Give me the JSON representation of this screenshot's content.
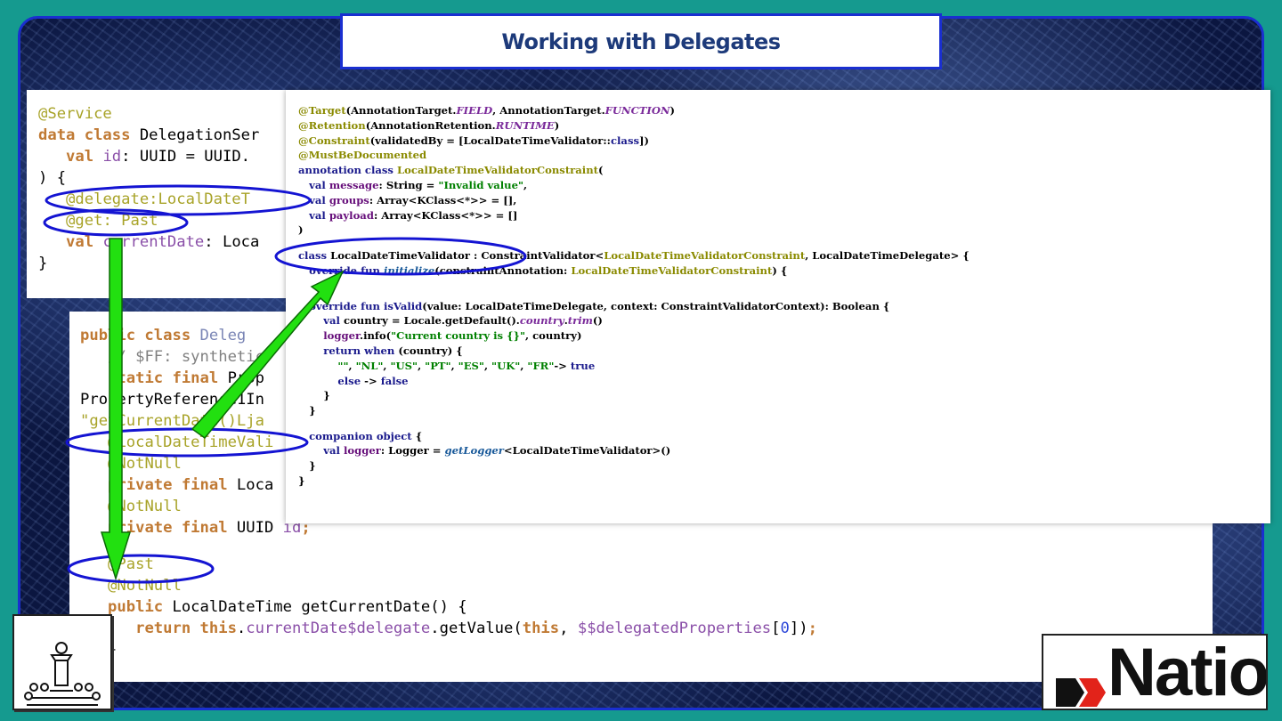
{
  "slide": {
    "title": "Working with Delegates"
  },
  "kotlin_panel": {
    "lines": [
      [
        {
          "t": "@Service",
          "c": "ann"
        }
      ],
      [
        {
          "t": "data class ",
          "c": "kw"
        },
        {
          "t": "DelegationSer",
          "c": ""
        }
      ],
      [
        {
          "t": "   ",
          "c": ""
        },
        {
          "t": "val ",
          "c": "kw"
        },
        {
          "t": "id",
          "c": "prop"
        },
        {
          "t": ": UUID = UUID.",
          "c": ""
        }
      ],
      [
        {
          "t": ") {",
          "c": ""
        }
      ],
      [
        {
          "t": "   ",
          "c": ""
        },
        {
          "t": "@delegate:LocalDateT",
          "c": "ann"
        }
      ],
      [
        {
          "t": "   ",
          "c": ""
        },
        {
          "t": "@get: Past",
          "c": "ann"
        }
      ],
      [
        {
          "t": "   ",
          "c": ""
        },
        {
          "t": "val ",
          "c": "kw"
        },
        {
          "t": "currentDate",
          "c": "prop"
        },
        {
          "t": ": Loca",
          "c": ""
        }
      ],
      [
        {
          "t": "}",
          "c": ""
        }
      ]
    ]
  },
  "java_panel": {
    "lines": [
      [
        {
          "t": "public class ",
          "c": "kw"
        },
        {
          "t": "Deleg",
          "c": "dim"
        }
      ],
      [
        {
          "t": "   ",
          "c": ""
        },
        {
          "t": "// $FF: synthetic",
          "c": "cmt"
        }
      ],
      [
        {
          "t": "   ",
          "c": ""
        },
        {
          "t": "static final ",
          "c": "kw"
        },
        {
          "t": "Prop",
          "c": ""
        }
      ],
      [
        {
          "t": "PropertyReference1In",
          "c": ""
        }
      ],
      [
        {
          "t": "\"getCurrentDate()Lja",
          "c": "ann"
        }
      ],
      [
        {
          "t": "   ",
          "c": ""
        },
        {
          "t": "@LocalDateTimeVali",
          "c": "ann"
        }
      ],
      [
        {
          "t": "   ",
          "c": ""
        },
        {
          "t": "@NotNull",
          "c": "ann"
        }
      ],
      [
        {
          "t": "   ",
          "c": ""
        },
        {
          "t": "private final ",
          "c": "kw"
        },
        {
          "t": "Loca",
          "c": ""
        }
      ],
      [
        {
          "t": "   ",
          "c": ""
        },
        {
          "t": "@NotNull",
          "c": "ann"
        }
      ],
      [
        {
          "t": "   ",
          "c": ""
        },
        {
          "t": "private final ",
          "c": "kw"
        },
        {
          "t": "UUID ",
          "c": ""
        },
        {
          "t": "id",
          "c": "prop"
        },
        {
          "t": ";",
          "c": "kw"
        }
      ],
      [
        {
          "t": "",
          "c": ""
        }
      ],
      [
        {
          "t": "   ",
          "c": ""
        },
        {
          "t": "@Past",
          "c": "ann"
        }
      ],
      [
        {
          "t": "   ",
          "c": ""
        },
        {
          "t": "@NotNull",
          "c": "ann"
        }
      ],
      [
        {
          "t": "   ",
          "c": ""
        },
        {
          "t": "public ",
          "c": "kw"
        },
        {
          "t": "LocalDateTime getCurrentDate() {",
          "c": ""
        }
      ],
      [
        {
          "t": "      ",
          "c": ""
        },
        {
          "t": "return this",
          "c": "kw"
        },
        {
          "t": ".",
          "c": ""
        },
        {
          "t": "currentDate$delegate",
          "c": "prop"
        },
        {
          "t": ".getValue(",
          "c": ""
        },
        {
          "t": "this",
          "c": "kw"
        },
        {
          "t": ", ",
          "c": ""
        },
        {
          "t": "$$delegatedProperties",
          "c": "prop"
        },
        {
          "t": "[",
          "c": ""
        },
        {
          "t": "0",
          "c": "num"
        },
        {
          "t": "])",
          "c": ""
        },
        {
          "t": ";",
          "c": "kw"
        }
      ],
      [
        {
          "t": "   }",
          "c": ""
        }
      ]
    ]
  },
  "validator_panel": {
    "lines": [
      [
        {
          "t": "@Target",
          "c": "ca"
        },
        {
          "t": "(AnnotationTarget.",
          "c": ""
        },
        {
          "t": "FIELD",
          "c": "cp"
        },
        {
          "t": ", AnnotationTarget.",
          "c": ""
        },
        {
          "t": "FUNCTION",
          "c": "cp"
        },
        {
          "t": ")",
          "c": ""
        }
      ],
      [
        {
          "t": "@Retention",
          "c": "ca"
        },
        {
          "t": "(AnnotationRetention.",
          "c": ""
        },
        {
          "t": "RUNTIME",
          "c": "cp"
        },
        {
          "t": ")",
          "c": ""
        }
      ],
      [
        {
          "t": "@Constraint",
          "c": "ca"
        },
        {
          "t": "(validatedBy = [LocalDateTimeValidator::",
          "c": ""
        },
        {
          "t": "class",
          "c": "ck"
        },
        {
          "t": "])",
          "c": ""
        }
      ],
      [
        {
          "t": "@MustBeDocumented",
          "c": "ca"
        }
      ],
      [
        {
          "t": "annotation class ",
          "c": "ck"
        },
        {
          "t": "LocalDateTimeValidatorConstraint",
          "c": "ct"
        },
        {
          "t": "(",
          "c": ""
        }
      ],
      [
        {
          "t": "   ",
          "c": ""
        },
        {
          "t": "val ",
          "c": "ck"
        },
        {
          "t": "message",
          "c": "cv"
        },
        {
          "t": ": String = ",
          "c": ""
        },
        {
          "t": "\"Invalid value\"",
          "c": "cs"
        },
        {
          "t": ",",
          "c": ""
        }
      ],
      [
        {
          "t": "   ",
          "c": ""
        },
        {
          "t": "val ",
          "c": "ck"
        },
        {
          "t": "groups",
          "c": "cv"
        },
        {
          "t": ": Array<KClass<*>> = [],",
          "c": ""
        }
      ],
      [
        {
          "t": "   ",
          "c": ""
        },
        {
          "t": "val ",
          "c": "ck"
        },
        {
          "t": "payload",
          "c": "cv"
        },
        {
          "t": ": Array<KClass<*>> = []",
          "c": ""
        }
      ],
      [
        {
          "t": ")",
          "c": ""
        }
      ],
      [
        {
          "t": "",
          "c": ""
        }
      ],
      [
        {
          "t": "class ",
          "c": "ck"
        },
        {
          "t": "LocalDateTimeValidator : ConstraintValidator<",
          "c": ""
        },
        {
          "t": "LocalDateTimeValidatorConstraint",
          "c": "ct"
        },
        {
          "t": ", LocalDateTimeDelegate> {",
          "c": ""
        }
      ],
      [
        {
          "t": "   ",
          "c": ""
        },
        {
          "t": "override fun ",
          "c": "ck"
        },
        {
          "t": "initialize",
          "c": "cf"
        },
        {
          "t": "(constraintAnnotation: ",
          "c": ""
        },
        {
          "t": "LocalDateTimeValidatorConstraint",
          "c": "ct"
        },
        {
          "t": ") {",
          "c": ""
        }
      ],
      [
        {
          "t": "",
          "c": ""
        }
      ],
      [
        {
          "t": "",
          "c": ""
        }
      ],
      [
        {
          "t": "   ",
          "c": ""
        },
        {
          "t": "override fun ",
          "c": "ck"
        },
        {
          "t": "isValid",
          "c": "ck"
        },
        {
          "t": "(value: LocalDateTimeDelegate, context: ConstraintValidatorContext): Boolean {",
          "c": ""
        }
      ],
      [
        {
          "t": "       ",
          "c": ""
        },
        {
          "t": "val ",
          "c": "ck"
        },
        {
          "t": "country = Locale.getDefault().",
          "c": ""
        },
        {
          "t": "country",
          "c": "cp"
        },
        {
          "t": ".",
          "c": ""
        },
        {
          "t": "trim",
          "c": "cp"
        },
        {
          "t": "()",
          "c": ""
        }
      ],
      [
        {
          "t": "       ",
          "c": ""
        },
        {
          "t": "logger",
          "c": "cv"
        },
        {
          "t": ".info(",
          "c": ""
        },
        {
          "t": "\"Current country is {}\"",
          "c": "cs"
        },
        {
          "t": ", country)",
          "c": ""
        }
      ],
      [
        {
          "t": "       ",
          "c": ""
        },
        {
          "t": "return when ",
          "c": "ck"
        },
        {
          "t": "(country) {",
          "c": ""
        }
      ],
      [
        {
          "t": "           ",
          "c": ""
        },
        {
          "t": "\"\"",
          "c": "cs"
        },
        {
          "t": ", ",
          "c": ""
        },
        {
          "t": "\"NL\"",
          "c": "cs"
        },
        {
          "t": ", ",
          "c": ""
        },
        {
          "t": "\"US\"",
          "c": "cs"
        },
        {
          "t": ", ",
          "c": ""
        },
        {
          "t": "\"PT\"",
          "c": "cs"
        },
        {
          "t": ", ",
          "c": ""
        },
        {
          "t": "\"ES\"",
          "c": "cs"
        },
        {
          "t": ", ",
          "c": ""
        },
        {
          "t": "\"UK\"",
          "c": "cs"
        },
        {
          "t": ", ",
          "c": ""
        },
        {
          "t": "\"FR\"",
          "c": "cs"
        },
        {
          "t": "-> ",
          "c": ""
        },
        {
          "t": "true",
          "c": "ck"
        }
      ],
      [
        {
          "t": "           ",
          "c": ""
        },
        {
          "t": "else ",
          "c": "ck"
        },
        {
          "t": "-> ",
          "c": ""
        },
        {
          "t": "false",
          "c": "ck"
        }
      ],
      [
        {
          "t": "       }",
          "c": ""
        }
      ],
      [
        {
          "t": "   }",
          "c": ""
        }
      ],
      [
        {
          "t": "",
          "c": ""
        }
      ],
      [
        {
          "t": "   ",
          "c": ""
        },
        {
          "t": "companion object ",
          "c": "ck"
        },
        {
          "t": "{",
          "c": ""
        }
      ],
      [
        {
          "t": "       ",
          "c": ""
        },
        {
          "t": "val ",
          "c": "ck"
        },
        {
          "t": "logger",
          "c": "cv"
        },
        {
          "t": ": Logger = ",
          "c": ""
        },
        {
          "t": "getLogger",
          "c": "cf"
        },
        {
          "t": "<LocalDateTimeValidator>()",
          "c": ""
        }
      ],
      [
        {
          "t": "   }",
          "c": ""
        }
      ],
      [
        {
          "t": "}",
          "c": ""
        }
      ]
    ]
  },
  "logo": {
    "brand_word": "Nation",
    "left_logo_icon": "chess-audience-icon"
  },
  "colors": {
    "background": "#159a8f",
    "frame_border": "#1a2fd0",
    "highlight_ellipse": "#1414d2",
    "arrow": "#22e010",
    "title_text": "#1d3a7a"
  }
}
